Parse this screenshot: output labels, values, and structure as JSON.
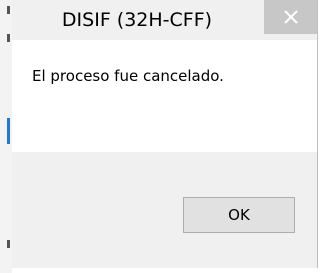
{
  "dialog": {
    "title": "DISIF (32H-CFF)",
    "message": "El proceso fue cancelado.",
    "ok_label": "OK",
    "close_icon": "close-icon"
  },
  "colors": {
    "title_bar": "#f0f0f0",
    "close_button": "#c7c7c7",
    "footer": "#f0f0f0",
    "accent": "#1e78d6"
  }
}
